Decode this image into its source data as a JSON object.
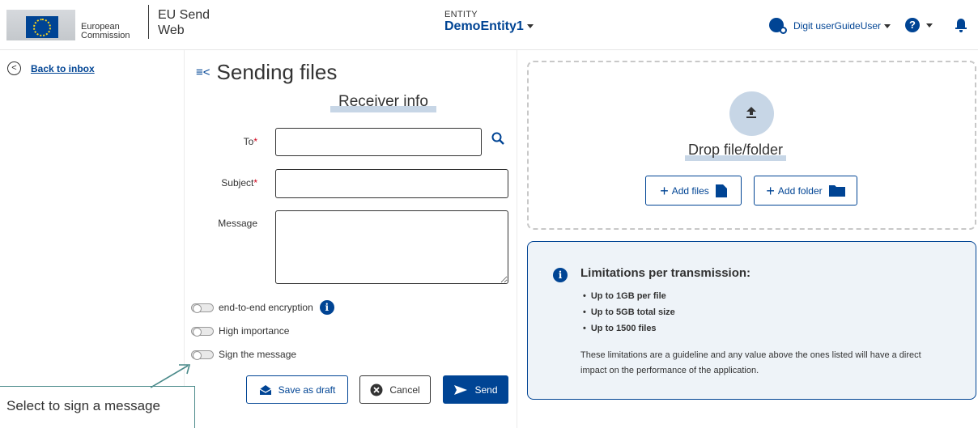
{
  "header": {
    "org_line1": "European",
    "org_line2": "Commission",
    "app_line1": "EU Send",
    "app_line2": "Web",
    "entity_label": "ENTITY",
    "entity_value": "DemoEntity1",
    "user_name": "Digit userGuideUser",
    "help_symbol": "?"
  },
  "nav": {
    "back_label": "Back to inbox",
    "back_symbol": "<"
  },
  "form": {
    "title": "Sending files",
    "section": "Receiver info",
    "to_label": "To",
    "subject_label": "Subject",
    "message_label": "Message",
    "required_mark": "*",
    "to_value": "",
    "subject_value": "",
    "message_value": "",
    "toggles": {
      "encryption": "end-to-end encryption",
      "importance": "High importance",
      "sign": "Sign the message"
    },
    "info_symbol": "i",
    "buttons": {
      "draft": "Save as draft",
      "cancel": "Cancel",
      "send": "Send"
    }
  },
  "drop": {
    "text": "Drop file/folder",
    "add_files": "Add files",
    "add_folder": "Add folder",
    "plus": "+"
  },
  "limits": {
    "title": "Limitations per transmission:",
    "items": [
      "Up to 1GB per file",
      "Up to 5GB total size",
      "Up to 1500 files"
    ],
    "note": "These limitations are a guideline and any value above the ones listed will have a direct impact on the performance of the application.",
    "info_symbol": "i"
  },
  "callout": {
    "text": "Select to sign a message"
  },
  "colors": {
    "primary": "#004494",
    "highlight": "#c7d6e6",
    "panel": "#eef3f8",
    "required": "#d0021b",
    "callout_border": "#4a8a8a"
  },
  "icons": [
    "eu-flag-icon",
    "user-settings-icon",
    "help-icon",
    "bell-icon",
    "back-icon",
    "menu-collapse-icon",
    "search-icon",
    "info-icon",
    "envelope-icon",
    "cancel-icon",
    "send-icon",
    "upload-icon",
    "file-icon",
    "folder-icon"
  ]
}
